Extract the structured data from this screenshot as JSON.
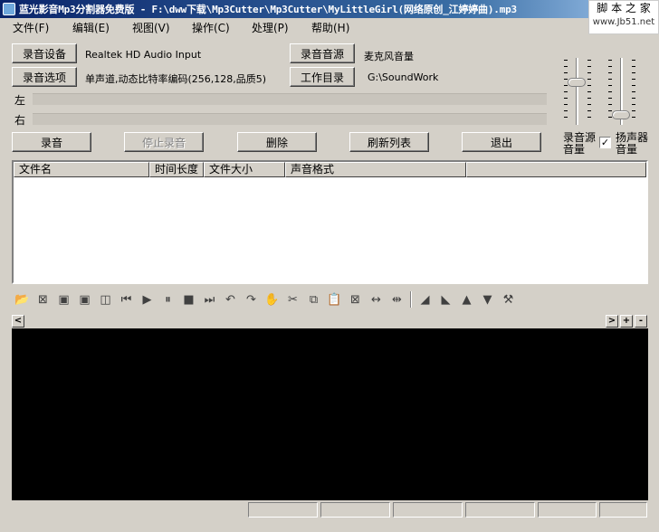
{
  "window": {
    "title": "蓝光影音Mp3分割器免费版 - F:\\dww下载\\Mp3Cutter\\Mp3Cutter\\MyLittleGirl(网络原创_江婷婷曲).mp3"
  },
  "watermark": {
    "line1": "脚 本 之 家",
    "line2": "www.Jb51.net"
  },
  "menu": [
    {
      "label": "文件(F)"
    },
    {
      "label": "编辑(E)"
    },
    {
      "label": "视图(V)"
    },
    {
      "label": "操作(C)"
    },
    {
      "label": "处理(P)"
    },
    {
      "label": "帮助(H)"
    }
  ],
  "settings": {
    "device_button": "录音设备",
    "device_value": "Realtek HD Audio Input",
    "options_button": "录音选项",
    "options_value": "单声道,动态比特率编码(256,128,品质5)",
    "source_button": "录音音源",
    "source_value": "麦克风音量",
    "workdir_button": "工作目录",
    "workdir_value": "G:\\SoundWork"
  },
  "meters": {
    "left_label": "左",
    "right_label": "右"
  },
  "actions": {
    "record": "录音",
    "stop": "停止录音",
    "delete": "删除",
    "refresh": "刷新列表",
    "exit": "退出"
  },
  "volume": {
    "source_label": "录音源\n音量",
    "speaker_label": "扬声器\n音量",
    "speaker_checked": true,
    "source_level": 0.65,
    "speaker_level": 0.1
  },
  "list": {
    "columns": [
      "文件名",
      "时间长度",
      "文件大小",
      "声音格式"
    ],
    "rows": []
  },
  "toolbar_icons": [
    "open-folder-icon",
    "close-file-icon",
    "save-icon",
    "save-as-icon",
    "export-icon",
    "go-start-icon",
    "play-icon",
    "pause-icon",
    "stop-icon",
    "go-end-icon",
    "undo-icon",
    "redo-icon",
    "hand-icon",
    "cut-icon",
    "copy-icon",
    "paste-icon",
    "crop-icon",
    "expand-icon",
    "shrink-icon",
    "fade-in-icon",
    "fade-out-icon",
    "volume-up-icon",
    "volume-down-icon",
    "tools-icon"
  ],
  "scroll": {
    "left": "<",
    "right": ">",
    "plus": "+",
    "minus": "-"
  }
}
